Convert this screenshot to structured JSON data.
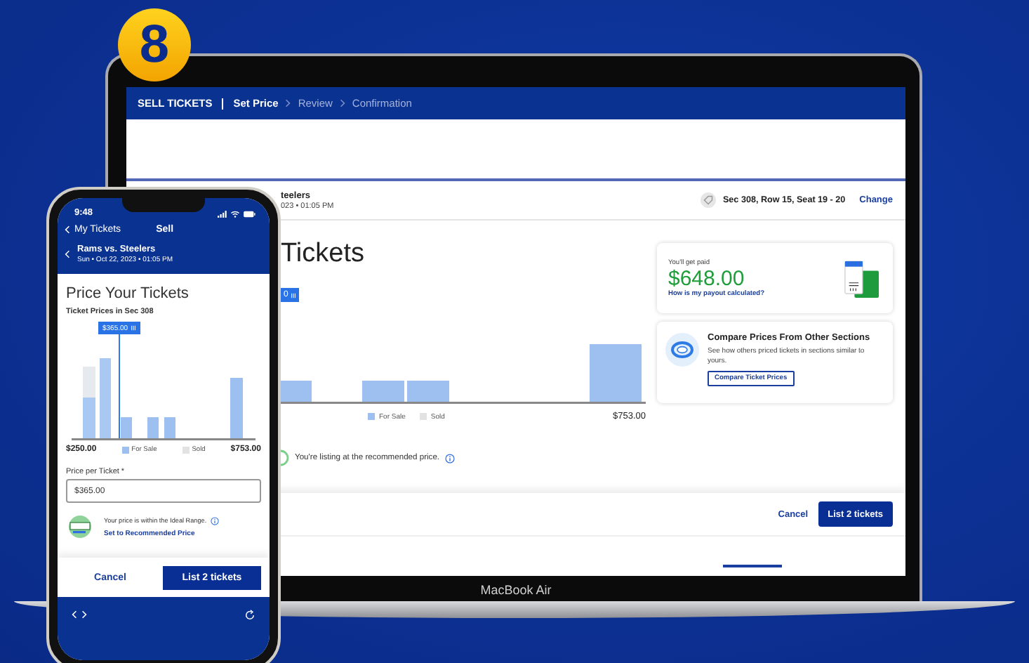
{
  "badge": {
    "label": "8"
  },
  "laptop": {
    "nav": {
      "title": "SELL TICKETS",
      "steps": [
        {
          "label": "Set Price",
          "selected": true
        },
        {
          "label": "Review",
          "selected": false
        },
        {
          "label": "Confirmation",
          "selected": false
        }
      ]
    },
    "event": {
      "name": "teelers",
      "date": "023 • 01:05 PM",
      "seats": "Sec 308, Row 15, Seat 19 - 20",
      "change": "Change"
    },
    "heading": "Tickets",
    "price_tag": "0",
    "legend": [
      "For Sale",
      "Sold"
    ],
    "max_price": "$753.00",
    "message": "You're listing at the recommended price.",
    "payout": {
      "label": "You'll get paid",
      "amount": "$648.00",
      "link": "How is my payout calculated?"
    },
    "compare": {
      "title": "Compare Prices From Other Sections",
      "text": "See how others priced tickets in sections similar to yours.",
      "button": "Compare Ticket Prices"
    },
    "buttons": {
      "cancel": "Cancel",
      "submit": "List 2 tickets"
    },
    "device_label": "MacBook Air"
  },
  "phone": {
    "time": "9:48",
    "back": "My Tickets",
    "title": "Sell",
    "event": {
      "name": "Rams vs. Steelers",
      "date": "Sun • Oct 22, 2023 • 01:05 PM"
    },
    "heading": "Price Your Tickets",
    "chart_title": "Ticket Prices in Sec 308",
    "price_tag": "$365.00",
    "min_price": "$250.00",
    "max_price": "$753.00",
    "legend": [
      "For Sale",
      "Sold"
    ],
    "price_field": {
      "label": "Price per Ticket *",
      "value": "$365.00"
    },
    "range_text": "Your price is within the Ideal Range.",
    "recommend_link": "Set to Recommended Price",
    "buttons": {
      "cancel": "Cancel",
      "submit": "List 2 tickets"
    }
  }
}
